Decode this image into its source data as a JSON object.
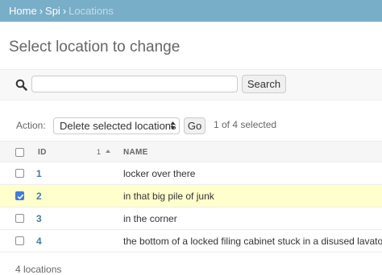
{
  "breadcrumbs": {
    "home": "Home",
    "app": "Spi",
    "separator": "›",
    "current": "Locations"
  },
  "page_title": "Select location to change",
  "search": {
    "value": "",
    "placeholder": "",
    "button_label": "Search",
    "icon": "search-icon"
  },
  "actions": {
    "label": "Action:",
    "selected_option": "Delete selected locations",
    "go_label": "Go",
    "selection_count": "1 of 4 selected"
  },
  "table": {
    "columns": {
      "id": "ID",
      "sort_priority": "1",
      "name": "NAME"
    },
    "rows": [
      {
        "id": "1",
        "name": "locker over there",
        "checked": false
      },
      {
        "id": "2",
        "name": "in that big pile of junk",
        "checked": true
      },
      {
        "id": "3",
        "name": "in the corner",
        "checked": false
      },
      {
        "id": "4",
        "name": "the bottom of a locked filing cabinet stuck in a disused lavatory w",
        "checked": false
      }
    ]
  },
  "paginator": "4 locations",
  "colors": {
    "header_bar": "#79aec8",
    "link": "#447e9b",
    "selected_row": "#ffffcc",
    "checkbox_checked": "#417ae0"
  }
}
